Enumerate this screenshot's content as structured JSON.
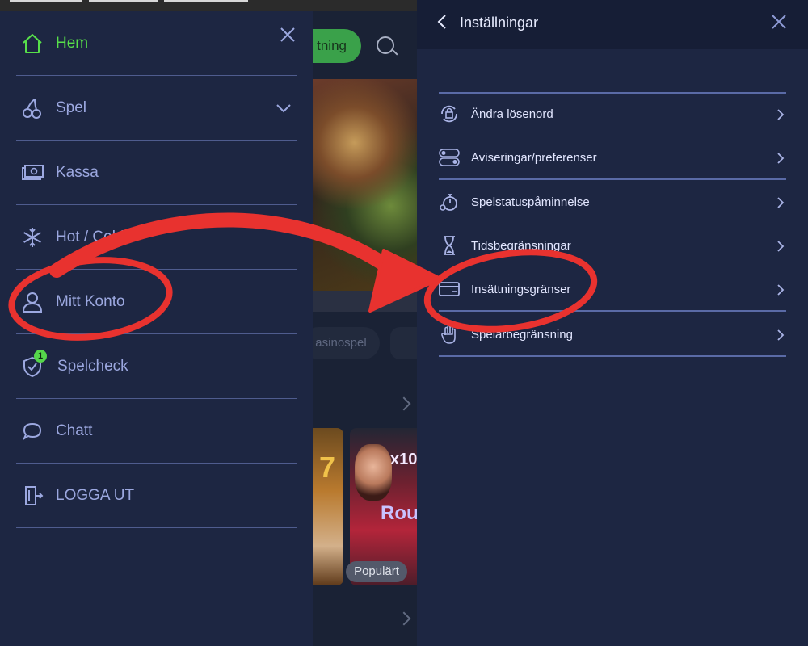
{
  "drawer": {
    "items": [
      {
        "label": "Hem",
        "icon": "home-icon",
        "active": true
      },
      {
        "label": "Spel",
        "icon": "cherries-icon",
        "has_chevron": true
      },
      {
        "label": "Kassa",
        "icon": "cash-icon"
      },
      {
        "label": "Hot / Cold",
        "icon": "snowflake-icon"
      },
      {
        "label": "Mitt Konto",
        "icon": "user-icon"
      },
      {
        "label": "Spelcheck",
        "icon": "shield-check-icon",
        "badge": "1"
      },
      {
        "label": "Chatt",
        "icon": "chat-icon"
      },
      {
        "label": "LOGGA UT",
        "icon": "logout-icon"
      }
    ],
    "colors": {
      "background": "#1d2642",
      "text": "#9ca8e0",
      "active": "#57e04a",
      "divider": "#4f5c8e",
      "badge": "#55d64b"
    }
  },
  "background_app": {
    "cta_partial_label": "tning",
    "chip_partial_label": "asinospel",
    "card_badge_label": "Populärt",
    "card1_text": "7",
    "card2_text_top": "x10",
    "card2_text_bottom": "Rou"
  },
  "settings": {
    "title": "Inställningar",
    "items": [
      {
        "label": "Ändra lösenord",
        "icon": "lock-refresh-icon"
      },
      {
        "label": "Aviseringar/preferenser",
        "icon": "toggles-icon"
      },
      {
        "label": "Spelstatuspåminnelse",
        "icon": "timer-icon"
      },
      {
        "label": "Tidsbegränsningar",
        "icon": "hourglass-icon"
      },
      {
        "label": "Insättningsgränser",
        "icon": "credit-card-icon"
      },
      {
        "label": "Spelarbegränsning",
        "icon": "hand-icon"
      }
    ],
    "colors": {
      "background": "#1d2642",
      "header": "#161e36",
      "text": "#e2e6ff",
      "divider": "#5a6aa6"
    }
  },
  "annotation": {
    "color": "#e8322f"
  }
}
